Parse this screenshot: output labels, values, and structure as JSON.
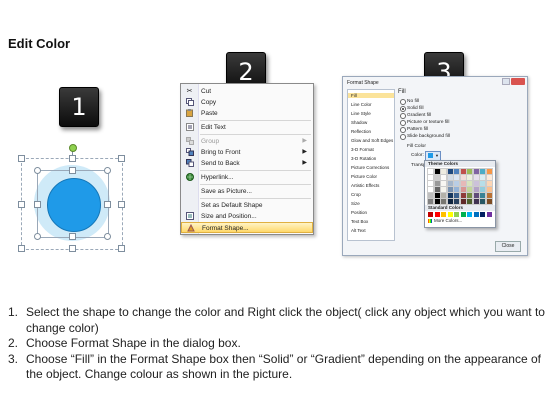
{
  "page_title": "Edit Color",
  "steps": {
    "one": "1",
    "two": "2",
    "three": "3"
  },
  "context_menu": {
    "items": [
      {
        "label": "Cut",
        "icon": "scissors-icon",
        "state": "normal"
      },
      {
        "label": "Copy",
        "icon": "copy-icon",
        "state": "normal"
      },
      {
        "label": "Paste",
        "icon": "paste-icon",
        "state": "normal"
      },
      {
        "label": "Edit Text",
        "icon": "edit-text-icon",
        "state": "normal"
      },
      {
        "label": "Group",
        "icon": "group-icon",
        "state": "disabled"
      },
      {
        "label": "Bring to Front",
        "icon": "bring-front-icon",
        "state": "normal"
      },
      {
        "label": "Send to Back",
        "icon": "send-back-icon",
        "state": "normal"
      },
      {
        "label": "Hyperlink...",
        "icon": "hyperlink-icon",
        "state": "normal"
      },
      {
        "label": "Save as Picture...",
        "icon": "",
        "state": "normal"
      },
      {
        "label": "Set as Default Shape",
        "icon": "",
        "state": "normal"
      },
      {
        "label": "Size and Position...",
        "icon": "size-position-icon",
        "state": "normal"
      },
      {
        "label": "Format Shape...",
        "icon": "format-shape-icon",
        "state": "highlighted"
      }
    ]
  },
  "format_dialog": {
    "title": "Format Shape",
    "close_label": "Close",
    "categories": [
      "Fill",
      "Line Color",
      "Line Style",
      "Shadow",
      "Reflection",
      "Glow and Soft Edges",
      "3-D Format",
      "3-D Rotation",
      "Picture Corrections",
      "Picture Color",
      "Artistic Effects",
      "Crop",
      "Size",
      "Position",
      "Text Box",
      "Alt Text"
    ],
    "selected_category": "Fill",
    "section_title": "Fill",
    "fill_options": [
      "No fill",
      "Solid fill",
      "Gradient fill",
      "Picture or texture fill",
      "Pattern fill",
      "Slide background fill"
    ],
    "selected_fill": "Solid fill",
    "fill_color_label": "Fill Color",
    "color_label": "Color:",
    "transparency_label": "Transparency:",
    "theme_colors_label": "Theme Colors",
    "standard_colors_label": "Standard Colors",
    "more_colors_label": "More Colors..."
  },
  "colors": {
    "shape_fill": "#1f9ae8",
    "shape_halo": "#cfeaf8",
    "theme_top": [
      "#ffffff",
      "#000000",
      "#eeece1",
      "#1f497d",
      "#4f81bd",
      "#c0504d",
      "#9bbb59",
      "#8064a2",
      "#4bacc6",
      "#f79646"
    ],
    "standard": [
      "#c00000",
      "#ff0000",
      "#ffc000",
      "#ffff00",
      "#92d050",
      "#00b050",
      "#00b0f0",
      "#0070c0",
      "#002060",
      "#7030a0"
    ]
  },
  "instructions": [
    {
      "num": "1.",
      "text": "Select the shape to change the color and Right click the object( click any object which you want to change color)"
    },
    {
      "num": "2.",
      "text": "Choose Format Shape in the dialog box."
    },
    {
      "num": "3.",
      "text": "Choose “Fill” in the Format Shape box then “Solid” or “Gradient” depending on the appearance of the object. Change colour as shown in the picture."
    }
  ]
}
